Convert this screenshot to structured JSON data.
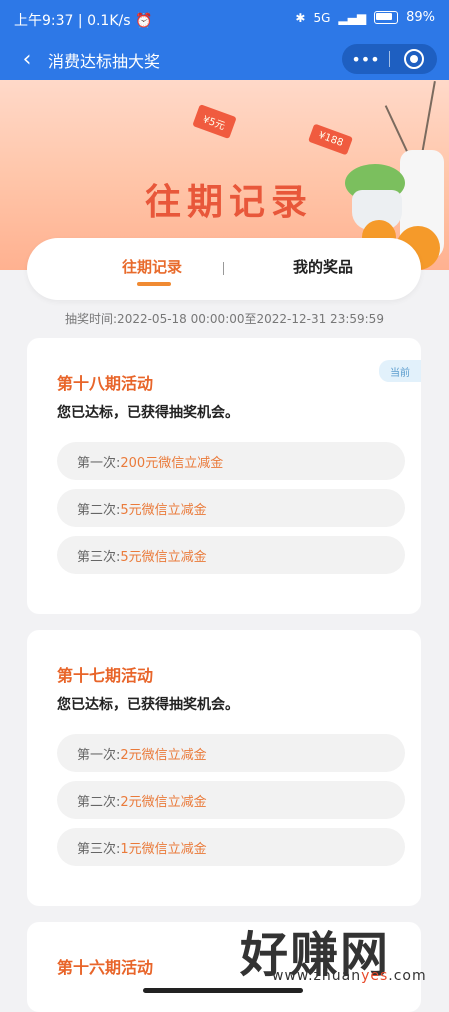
{
  "status_bar": {
    "time": "上午9:37",
    "speed": "| 0.1K/s",
    "signal": "5G",
    "battery": "89%"
  },
  "nav": {
    "title": "消费达标抽大奖",
    "more": "•••"
  },
  "banner": {
    "title": "往期记录",
    "ticket_left": "¥5元",
    "ticket_right": "¥188"
  },
  "tabs": {
    "active": "往期记录",
    "other": "我的奖品"
  },
  "time_range": "抽奖时间:2022-05-18 00:00:00至2022-12-31 23:59:59",
  "cards": [
    {
      "title": "第十八期活动",
      "badge": "当前",
      "subtitle": "您已达标，已获得抽奖机会。",
      "prizes": [
        {
          "label": "第一次:",
          "value": "200元微信立减金"
        },
        {
          "label": "第二次:",
          "value": "5元微信立减金"
        },
        {
          "label": "第三次:",
          "value": "5元微信立减金"
        }
      ]
    },
    {
      "title": "第十七期活动",
      "subtitle": "您已达标，已获得抽奖机会。",
      "prizes": [
        {
          "label": "第一次:",
          "value": "2元微信立减金"
        },
        {
          "label": "第二次:",
          "value": "2元微信立减金"
        },
        {
          "label": "第三次:",
          "value": "1元微信立减金"
        }
      ]
    },
    {
      "title": "第十六期活动"
    }
  ],
  "watermark": {
    "text": "好赚网",
    "url_a": "www.zhuan",
    "url_b": "yes",
    "url_c": ".com"
  }
}
